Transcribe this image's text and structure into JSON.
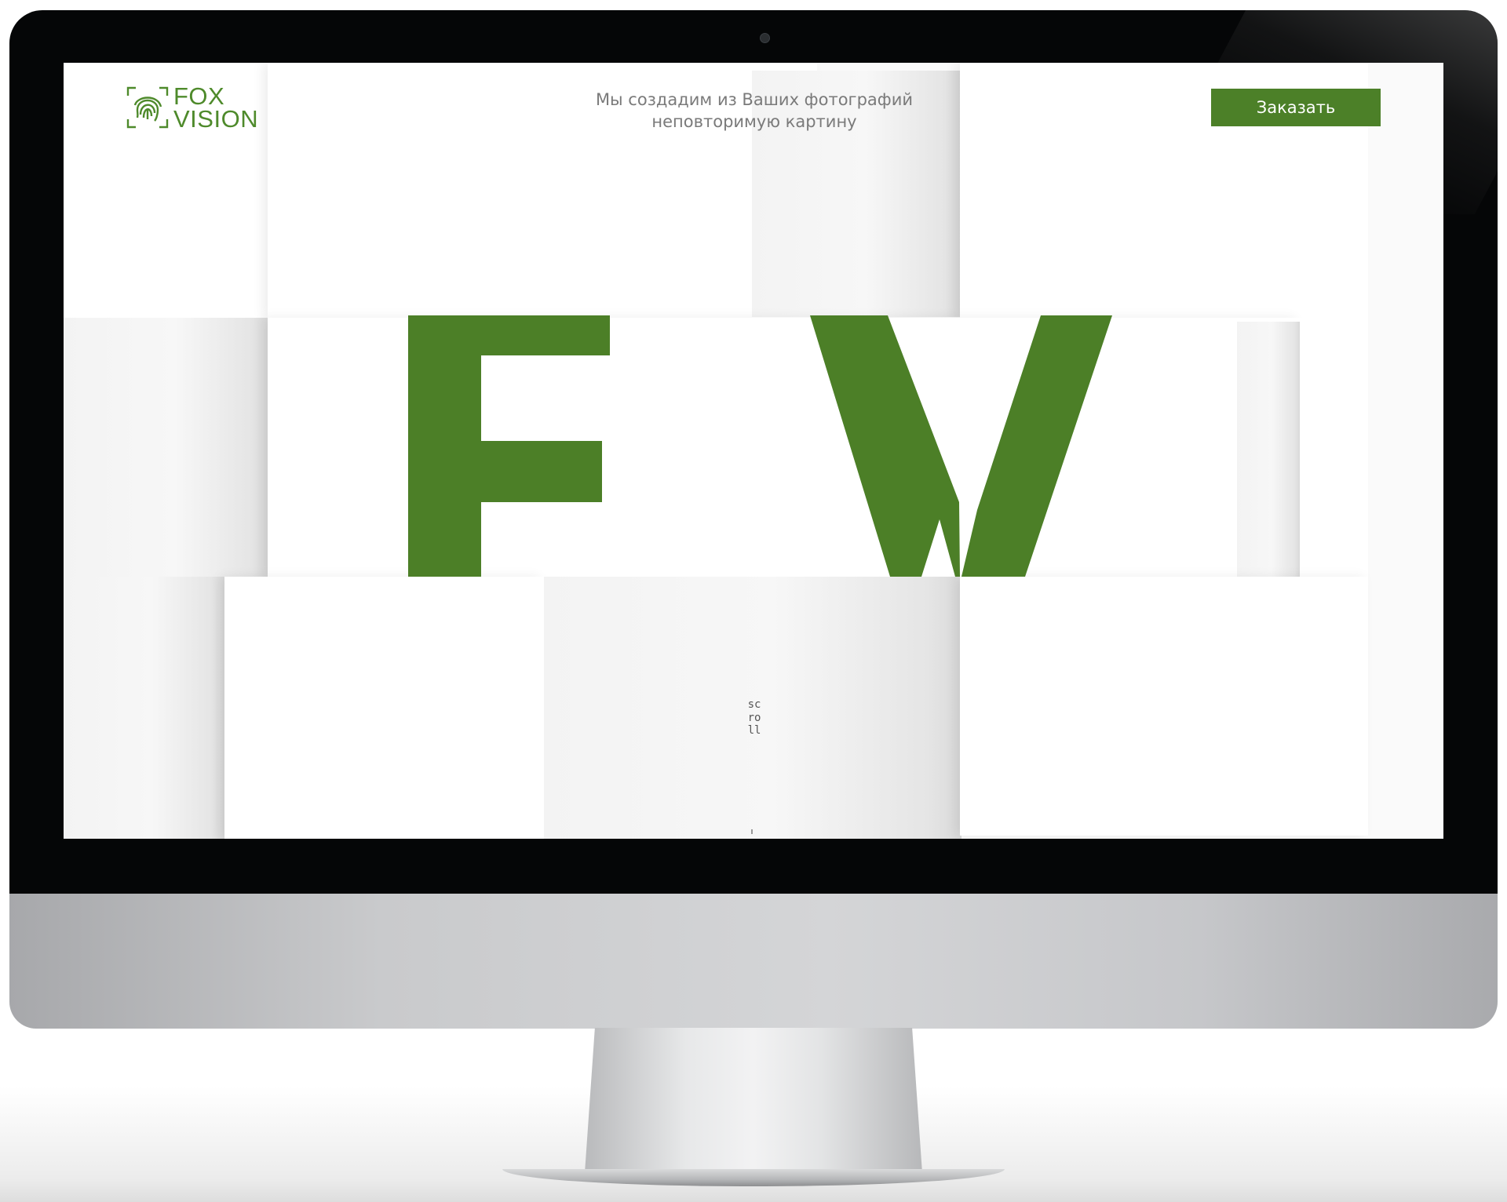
{
  "brand": {
    "line1": "FOX",
    "line2": "VISION",
    "color": "#4e8a2b"
  },
  "header": {
    "tagline_line1": "Мы создадим из Ваших фотографий",
    "tagline_line2": "неповторимую картину",
    "order_button": "Заказать"
  },
  "hero": {
    "letters": "F V",
    "accent_color": "#4c7f27"
  },
  "scroll_hint": "scroll",
  "icons": {
    "logo": "fingerprint-frame-icon"
  }
}
